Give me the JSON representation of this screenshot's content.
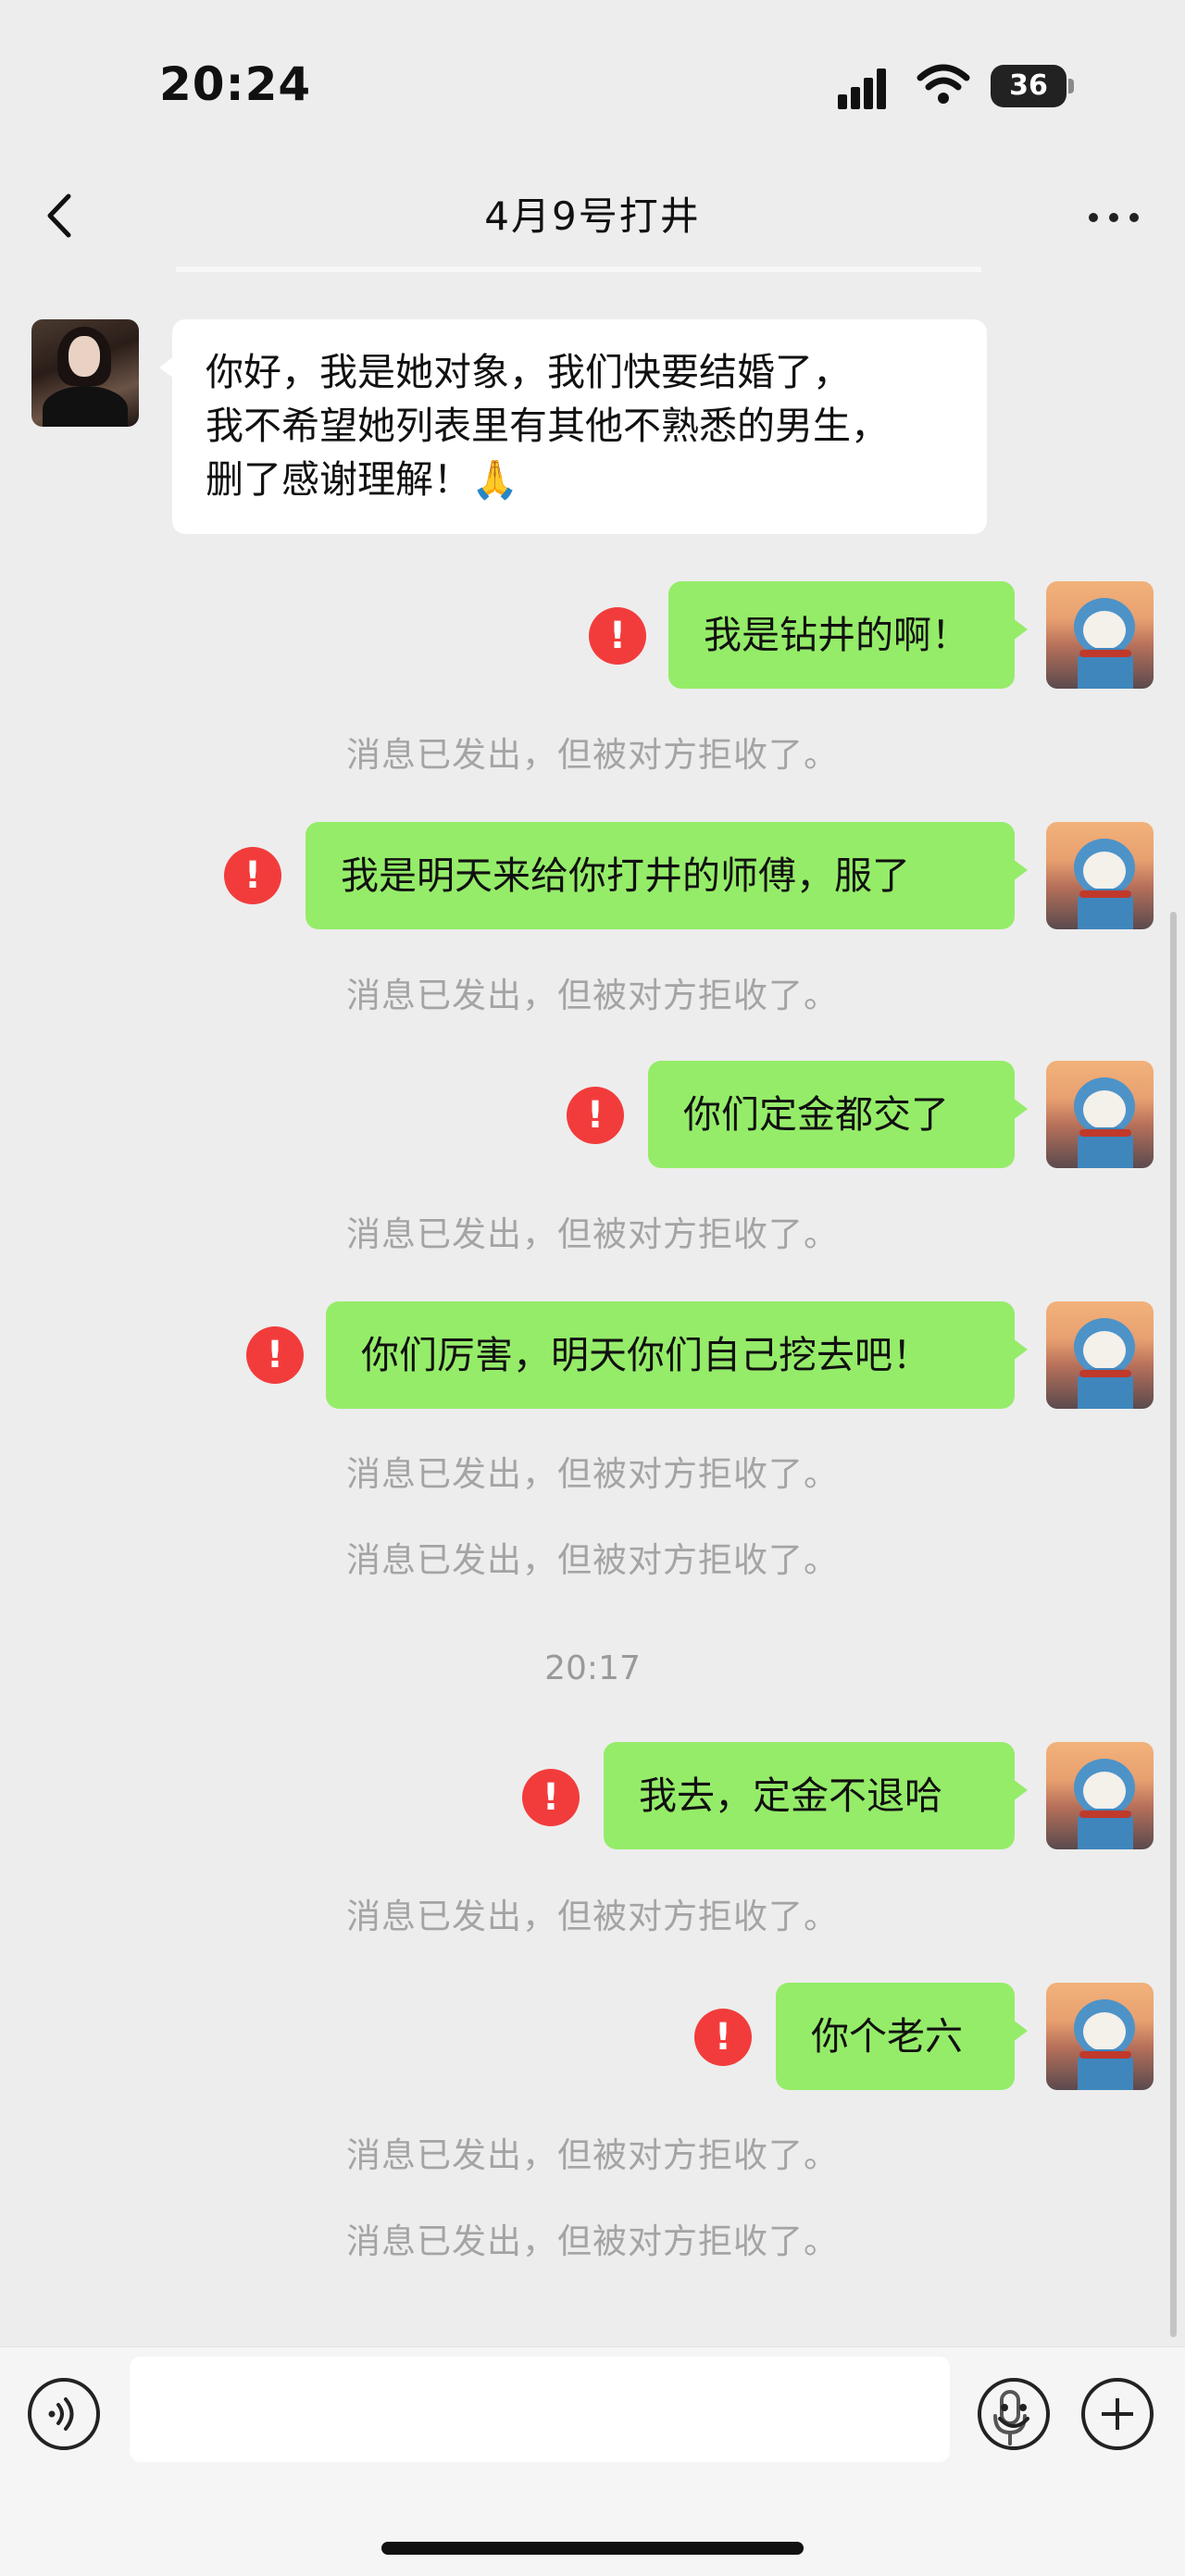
{
  "status": {
    "time": "20:24",
    "battery": "36"
  },
  "nav": {
    "title": "4月9号打井"
  },
  "messages": {
    "incoming": "你好，我是她对象，我们快要结婚了，\n我不希望她列表里有其他不熟悉的男生，\n删了感谢理解！🙏",
    "m1": "我是钻井的啊！",
    "m2": "我是明天来给你打井的师傅，服了",
    "m3": "你们定金都交了",
    "m4": "你们厉害，明天你们自己挖去吧！",
    "m5": "我去，定金不退哈",
    "m6": "你个老六"
  },
  "system_notice": "消息已发出，但被对方拒收了。",
  "timestamp": "20:17",
  "error_icon": "!",
  "colors": {
    "green_bubble": "#95ec69",
    "error_red": "#f23c3c",
    "background": "#ededed"
  },
  "icons": [
    "back-arrow-icon",
    "more-icon",
    "voice-icon",
    "microphone-icon",
    "emoji-icon",
    "plus-icon",
    "signal-icon",
    "wifi-icon",
    "battery-icon"
  ]
}
